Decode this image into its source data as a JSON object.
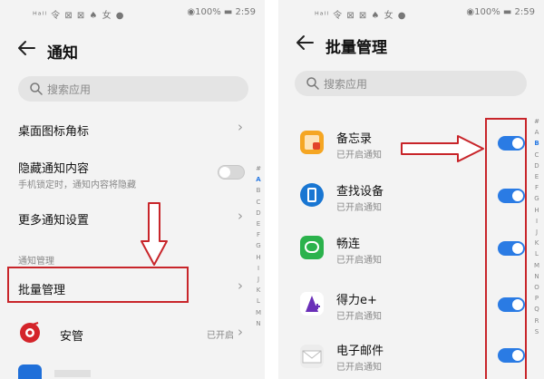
{
  "left": {
    "status": {
      "left": "ᴴᵃˡˡ 令 ⊠ ⊠ ♠ 女 ●",
      "right": "◉100% ▬ 2:59"
    },
    "title": "通知",
    "search_placeholder": "搜索应用",
    "rows": {
      "desktop_badge": "桌面图标角标",
      "hide_content": "隐藏通知内容",
      "hide_content_sub": "手机锁定时，通知内容将隐藏",
      "more_settings": "更多通知设置"
    },
    "section_label": "通知管理",
    "batch_manage": "批量管理",
    "app_row": {
      "name": "安管",
      "status": "已开启"
    },
    "alphabet": [
      "#",
      "A",
      "B",
      "C",
      "D",
      "E",
      "F",
      "G",
      "H",
      "I",
      "J",
      "K",
      "L",
      "M",
      "N"
    ]
  },
  "right": {
    "status": {
      "left": "ᴴᵃˡˡ 令 ⊠ ⊠ ♠ 女 ●",
      "right": "◉100% ▬ 2:59"
    },
    "title": "批量管理",
    "search_placeholder": "搜索应用",
    "apps": [
      {
        "name": "备忘录",
        "status": "已开启通知",
        "icon": "memo-icon",
        "enabled": true
      },
      {
        "name": "查找设备",
        "status": "已开启通知",
        "icon": "find-device-icon",
        "enabled": true
      },
      {
        "name": "畅连",
        "status": "已开启通知",
        "icon": "meetime-icon",
        "enabled": true
      },
      {
        "name": "得力e+",
        "status": "已开启通知",
        "icon": "deli-icon",
        "enabled": true
      },
      {
        "name": "电子邮件",
        "status": "已开启通知",
        "icon": "email-icon",
        "enabled": true
      }
    ],
    "alphabet": [
      "#",
      "A",
      "B",
      "C",
      "D",
      "E",
      "F",
      "G",
      "H",
      "I",
      "J",
      "K",
      "L",
      "M",
      "N",
      "O",
      "P",
      "Q",
      "R",
      "S"
    ]
  },
  "colors": {
    "accent": "#2a7be4",
    "annotation": "#c8252a"
  }
}
